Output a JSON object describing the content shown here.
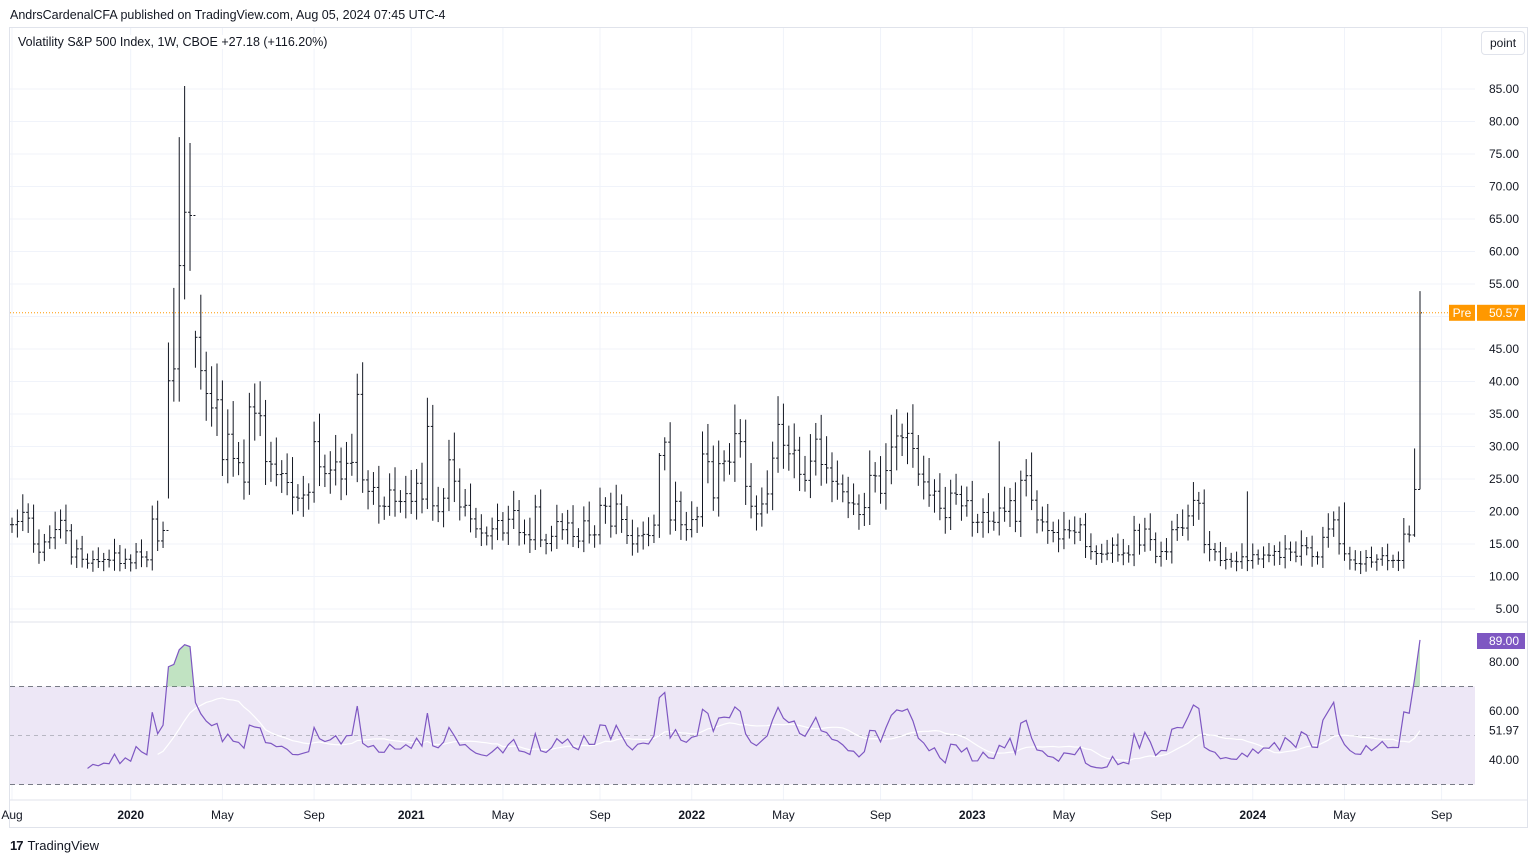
{
  "header": {
    "published": "AndrsCardenalCFA published on TradingView.com, Aug 05, 2024 07:45 UTC-4",
    "legend": "Volatility S&P 500 Index, 1W, CBOE  +27.18 (+116.20%)",
    "unit_button": "point"
  },
  "footer": {
    "logo": "TradingView"
  },
  "colors": {
    "bars": "#131722",
    "pre_line": "#ff9800",
    "rsi": "#7e57c2",
    "rsi_ma": "#ffffff",
    "band": "#ede7f6",
    "overbought": "#4caf50",
    "grid": "#f0f3fa"
  },
  "chart_data": {
    "type": "ohlc-bar",
    "title": "Volatility S&P 500 Index, 1W, CBOE",
    "start_week": "2019-08-05",
    "close": [
      17.97,
      18.47,
      19.87,
      18.98,
      15.0,
      13.74,
      15.32,
      15.96,
      17.22,
      18.64,
      17.04,
      13.0,
      14.25,
      12.65,
      12.05,
      12.6,
      12.3,
      12.62,
      12.51,
      13.62,
      12.0,
      12.65,
      12.1,
      13.78,
      13.0,
      12.56,
      18.84,
      15.47,
      17.08,
      40.11,
      41.94,
      57.83,
      66.04,
      65.54,
      46.8,
      41.67,
      38.15,
      35.93,
      37.19,
      27.98,
      31.89,
      28.16,
      27.51,
      24.52,
      36.09,
      35.12,
      34.73,
      27.68,
      27.29,
      25.68,
      25.84,
      24.46,
      22.21,
      22.05,
      22.54,
      22.96,
      30.75,
      26.87,
      25.83,
      26.38,
      27.63,
      25.0,
      27.41,
      27.55,
      38.02,
      24.86,
      23.1,
      23.7,
      20.84,
      20.79,
      23.31,
      21.57,
      21.53,
      22.75,
      21.56,
      24.34,
      21.91,
      33.09,
      20.87,
      19.97,
      22.05,
      27.95,
      24.66,
      20.69,
      20.95,
      18.86,
      17.33,
      16.69,
      16.25,
      17.33,
      18.61,
      16.69,
      18.81,
      20.15,
      16.76,
      16.42,
      15.65,
      20.7,
      15.62,
      15.07,
      16.18,
      18.45,
      17.2,
      18.24,
      16.15,
      15.45,
      18.56,
      16.39,
      16.41,
      20.95,
      20.81,
      17.75,
      21.15,
      18.77,
      16.3,
      15.01,
      16.26,
      16.48,
      16.29,
      17.91,
      28.62,
      30.67,
      18.69,
      21.57,
      17.96,
      17.22,
      18.76,
      19.19,
      28.85,
      27.66,
      22.09,
      27.36,
      27.75,
      27.59,
      31.98,
      30.75,
      23.87,
      20.81,
      19.63,
      21.16,
      22.7,
      28.21,
      33.4,
      30.19,
      28.87,
      29.43,
      25.72,
      24.79,
      27.75,
      31.13,
      27.23,
      26.7,
      24.64,
      24.23,
      23.03,
      21.33,
      21.15,
      19.53,
      20.6,
      25.56,
      25.47,
      22.79,
      26.3,
      29.92,
      31.62,
      31.36,
      32.02,
      29.69,
      25.75,
      24.55,
      22.52,
      23.12,
      20.5,
      19.06,
      22.83,
      22.62,
      20.87,
      21.67,
      18.33,
      18.35,
      19.85,
      18.51,
      18.33,
      20.53,
      20.02,
      21.67,
      18.49,
      24.8,
      25.51,
      21.74,
      18.7,
      18.4,
      17.07,
      16.77,
      15.78,
      17.19,
      17.03,
      16.81,
      17.95,
      14.6,
      13.83,
      13.54,
      13.44,
      13.59,
      14.83,
      13.34,
      13.6,
      13.33,
      17.1,
      14.84,
      17.3,
      15.68,
      13.09,
      13.84,
      13.79,
      17.2,
      17.52,
      17.45,
      19.32,
      21.71,
      21.27,
      14.91,
      14.17,
      13.8,
      12.46,
      12.63,
      12.35,
      12.28,
      13.03,
      12.45,
      13.35,
      12.7,
      13.3,
      13.26,
      13.85,
      12.93,
      14.24,
      13.75,
      13.11,
      14.74,
      14.41,
      13.06,
      13.01,
      16.03,
      17.31,
      18.71,
      15.03,
      13.49,
      12.55,
      11.99,
      11.93,
      12.92,
      12.22,
      12.66,
      13.2,
      12.44,
      12.48,
      12.46,
      16.52,
      16.39,
      23.39,
      50.57
    ],
    "high_overrides": {
      "29": 46.0,
      "30": 54.4,
      "31": 77.6,
      "32": 85.47,
      "33": 76.7,
      "34": 47.8,
      "64": 41.2,
      "77": 37.5,
      "120": 28.99,
      "121": 31.42,
      "143": 36.6,
      "163": 34.88,
      "183": 30.8,
      "229": 23.1,
      "247": 21.4,
      "260": 29.7,
      "261": 53.9
    },
    "low_overrides": {
      "261": 23.4,
      "260": 16.1,
      "29": 22.0
    },
    "price_axis": {
      "ticks": [
        5,
        10,
        15,
        20,
        25,
        30,
        35,
        40,
        45,
        50,
        55,
        60,
        65,
        70,
        75,
        80,
        85
      ],
      "range": [
        5,
        85
      ]
    },
    "pre_label": "Pre",
    "pre_value": 50.57,
    "rsi": {
      "period": 14,
      "ma_period": 14,
      "value_label": "89.00",
      "ma_value_label": "51.97",
      "ticks": [
        "40.00",
        "60.00",
        "80.00"
      ],
      "upper": 70,
      "lower": 30,
      "range": [
        30,
        80
      ]
    },
    "x_ticks": [
      {
        "label": "Aug",
        "week": 0,
        "bold": false
      },
      {
        "label": "2020",
        "week": 22,
        "bold": true
      },
      {
        "label": "May",
        "week": 39,
        "bold": false
      },
      {
        "label": "Sep",
        "week": 56,
        "bold": false
      },
      {
        "label": "2021",
        "week": 74,
        "bold": true
      },
      {
        "label": "May",
        "week": 91,
        "bold": false
      },
      {
        "label": "Sep",
        "week": 109,
        "bold": false
      },
      {
        "label": "2022",
        "week": 126,
        "bold": true
      },
      {
        "label": "May",
        "week": 143,
        "bold": false
      },
      {
        "label": "Sep",
        "week": 161,
        "bold": false
      },
      {
        "label": "2023",
        "week": 178,
        "bold": true
      },
      {
        "label": "May",
        "week": 195,
        "bold": false
      },
      {
        "label": "Sep",
        "week": 213,
        "bold": false
      },
      {
        "label": "2024",
        "week": 230,
        "bold": true
      },
      {
        "label": "May",
        "week": 247,
        "bold": false
      },
      {
        "label": "Sep",
        "week": 265,
        "bold": false
      }
    ]
  }
}
